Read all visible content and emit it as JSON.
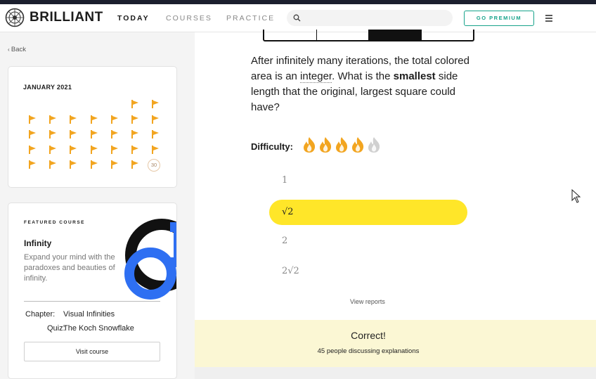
{
  "header": {
    "logo_text": "BRILLIANT",
    "nav": [
      {
        "label": "TODAY",
        "active": true
      },
      {
        "label": "COURSES",
        "active": false
      },
      {
        "label": "PRACTICE",
        "active": false
      }
    ],
    "search_placeholder": "",
    "premium_label": "GO PREMIUM",
    "icons": {
      "logo": "brilliant-logo-icon",
      "search": "search-icon",
      "menu": "hamburger-menu-icon"
    }
  },
  "sidebar": {
    "back_label": "Back",
    "calendar": {
      "title": "JANUARY 2021",
      "flag_color": "#f2a520",
      "last_day": "30"
    },
    "featured": {
      "label": "FEATURED COURSE",
      "title": "Infinity",
      "description": "Expand your mind with the paradoxes and beauties of infinity.",
      "chapter_label": "Chapter:",
      "chapter_value": "Visual Infinities",
      "quiz_label": "Quiz:",
      "quiz_value": "The Koch Snowflake",
      "button_label": "Visit course"
    }
  },
  "main": {
    "question_part1": "After infinitely many iterations, the total colored area is an ",
    "question_integer": "integer",
    "question_part2": ". What is the ",
    "question_bold": "smallest",
    "question_part3": " side length that the original, largest square could have?",
    "difficulty_label": "Difficulty:",
    "difficulty_level": 4,
    "difficulty_max": 5,
    "options": [
      "1",
      "√2",
      "2",
      "2√2"
    ],
    "selected_option": 1,
    "view_reports": "View reports",
    "correct_title": "Correct!",
    "correct_sub": "45 people discussing explanations",
    "colors": {
      "selected": "#ffe629",
      "fire": "#f2a520",
      "accent": "#17a38b"
    }
  }
}
